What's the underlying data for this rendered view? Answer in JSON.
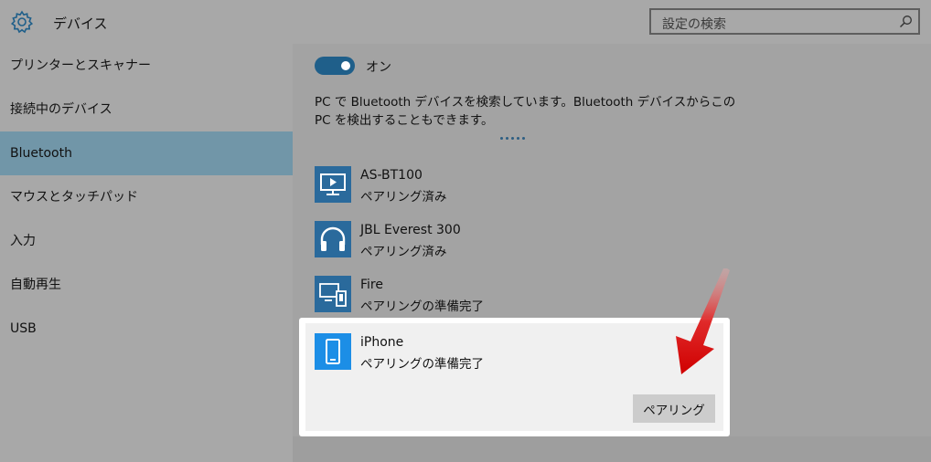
{
  "header": {
    "title": "デバイス",
    "gear_icon": "gear-icon",
    "search": {
      "placeholder": "設定の検索",
      "icon": "search-icon"
    }
  },
  "sidebar": {
    "items": [
      {
        "label": "プリンターとスキャナー",
        "selected": false
      },
      {
        "label": "接続中のデバイス",
        "selected": false
      },
      {
        "label": "Bluetooth",
        "selected": true
      },
      {
        "label": "マウスとタッチパッド",
        "selected": false
      },
      {
        "label": "入力",
        "selected": false
      },
      {
        "label": "自動再生",
        "selected": false
      },
      {
        "label": "USB",
        "selected": false
      }
    ]
  },
  "main": {
    "bluetooth_toggle": {
      "state_label": "オン",
      "on": true
    },
    "description": "PC で Bluetooth デバイスを検索しています。Bluetooth デバイスからこの PC を検出することもできます。",
    "devices": [
      {
        "name": "AS-BT100",
        "status": "ペアリング済み",
        "icon": "monitor-play-icon"
      },
      {
        "name": "JBL Everest 300",
        "status": "ペアリング済み",
        "icon": "headphones-icon"
      },
      {
        "name": "Fire",
        "status": "ペアリングの準備完了",
        "icon": "devices-icon"
      }
    ],
    "selected_device": {
      "name": "iPhone",
      "status": "ペアリングの準備完了",
      "icon": "phone-icon",
      "pair_button_label": "ペアリング"
    }
  },
  "colors": {
    "accent": "#1f5f8a",
    "selected_nav": "#7196a8",
    "device_icon_bg": "#2a6a9c",
    "highlight_icon_bg": "#1c8ee6",
    "arrow": "#e01010"
  }
}
